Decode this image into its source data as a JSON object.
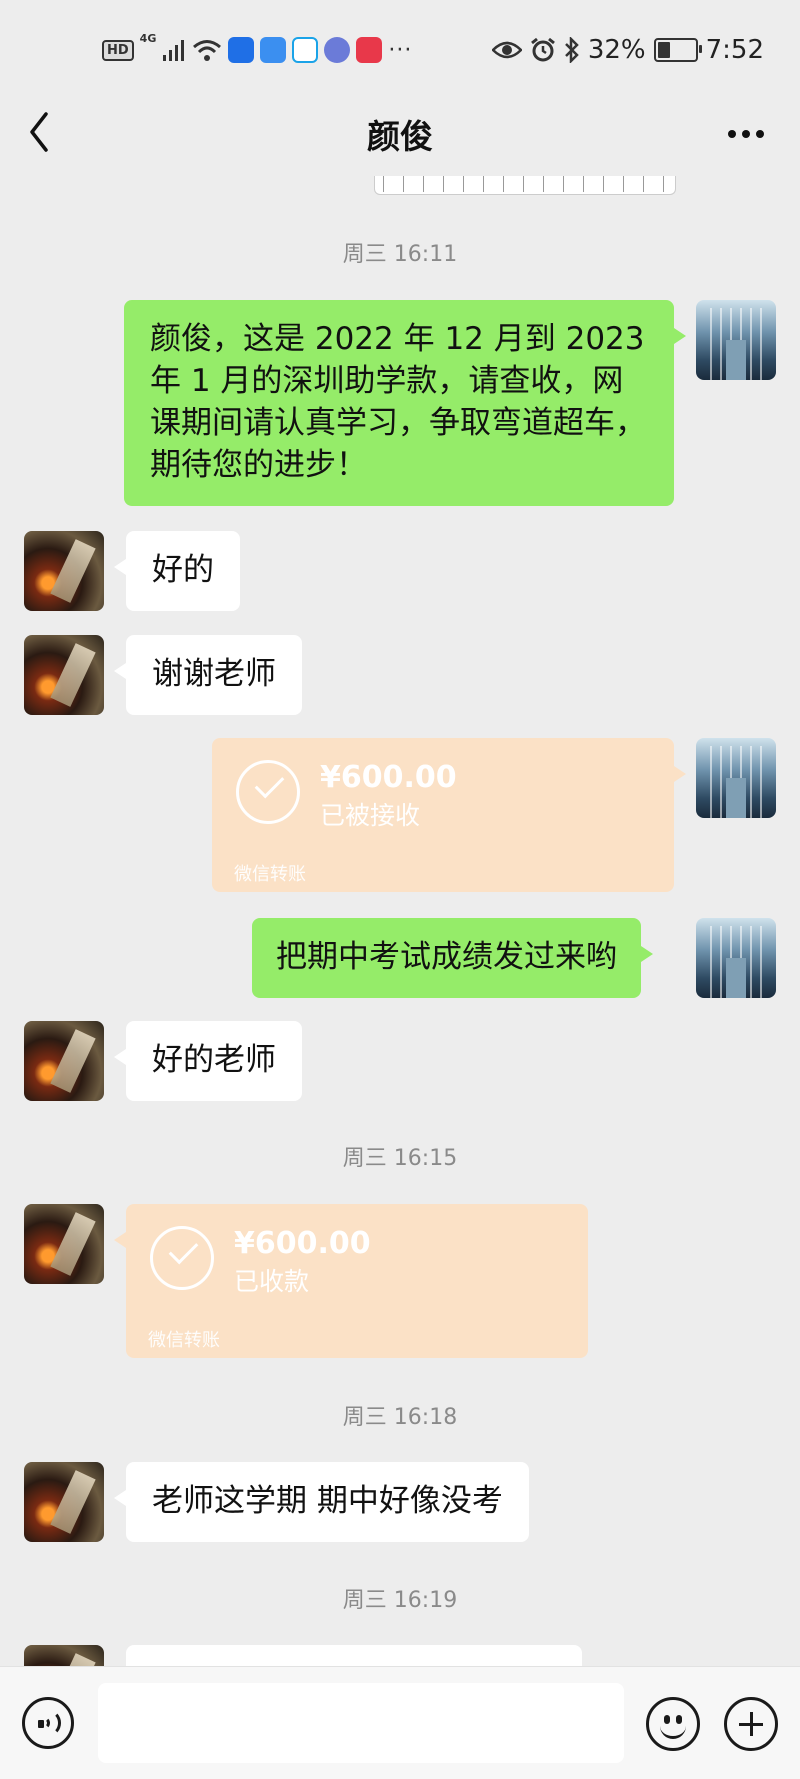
{
  "status_bar": {
    "hd": "HD",
    "network": "4G",
    "overflow": "···",
    "battery_percent": "32%",
    "battery_level": 0.32,
    "time": "7:52"
  },
  "header": {
    "title": "颜俊"
  },
  "messages": {
    "time1": "周三 16:11",
    "msg1": "颜俊，这是 2022 年 12 月到 2023 年 1 月的深圳助学款，请查收，网课期间请认真学习，争取弯道超车，期待您的进步！",
    "msg2": "好的",
    "msg3": "谢谢老师",
    "transfer1": {
      "amount": "¥600.00",
      "status": "已被接收",
      "label": "微信转账"
    },
    "msg4": "把期中考试成绩发过来哟",
    "msg5": "好的老师",
    "time2": "周三 16:15",
    "transfer2": {
      "amount": "¥600.00",
      "status": "已收款",
      "label": "微信转账"
    },
    "time3": "周三 16:18",
    "msg6": "老师这学期 期中好像没考",
    "time4": "周三 16:19"
  },
  "colors": {
    "sent_bubble": "#95ec69",
    "received_bubble": "#ffffff",
    "transfer_card": "#fbe1c6",
    "background": "#ededed"
  }
}
